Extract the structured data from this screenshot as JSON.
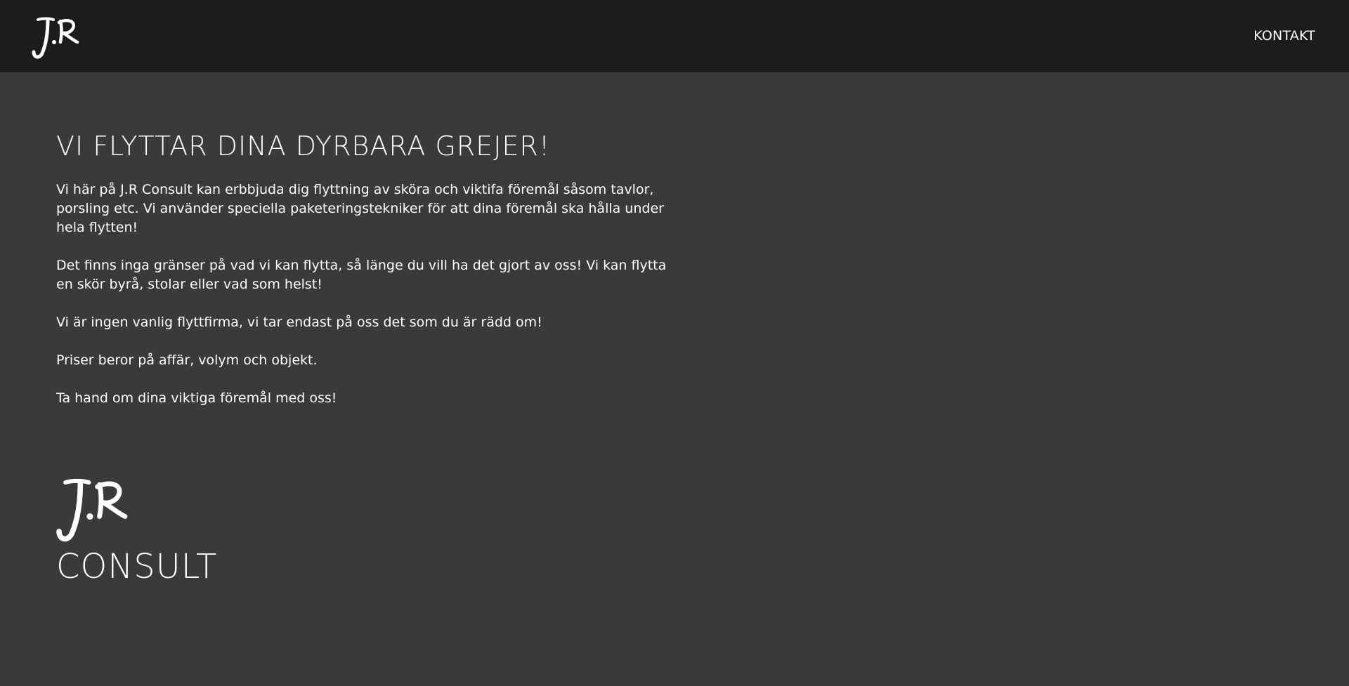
{
  "header": {
    "logo": {
      "icon": "jr-script-logo",
      "text": "J.R"
    },
    "nav": {
      "kontakt_label": "KONTAKT"
    }
  },
  "main": {
    "headline": "VI FLYTTAR DINA DYRBARA GREJER!",
    "paragraphs": [
      "Vi här på J.R Consult kan erbbjuda dig flyttning av sköra och viktifa föremål såsom tavlor, porsling etc. Vi använder speciella paketeringstekniker för att dina föremål ska hålla under hela flytten!",
      "Det finns inga gränser på vad vi kan flytta, så länge du vill ha det gjort av oss! Vi kan flytta en skör byrå, stolar eller vad som helst!",
      "Vi är ingen vanlig flyttfirma, vi tar endast på oss det som du är rädd om!",
      "Priser beror på affär, volym och objekt.",
      "Ta hand om dina viktiga föremål med oss!"
    ]
  },
  "footer": {
    "logo": {
      "icon": "jr-script-logo",
      "text": "J.R"
    },
    "consult_label": "CONSULT"
  },
  "colors": {
    "header_bg": "#1c1c1c",
    "page_bg": "#3a3a3a",
    "text": "#ffffff"
  }
}
